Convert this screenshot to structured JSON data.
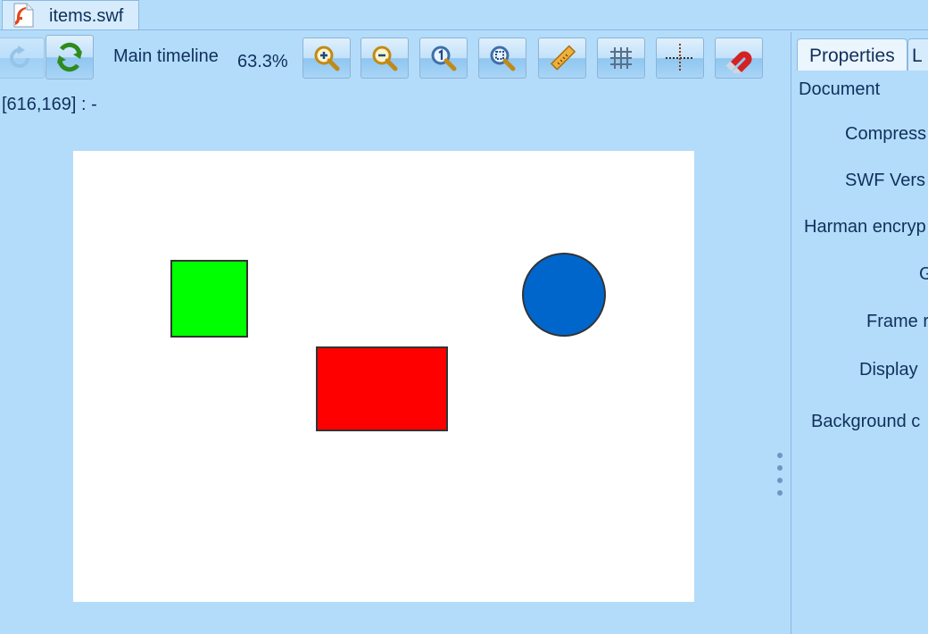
{
  "tab": {
    "filename": "items.swf"
  },
  "toolbar": {
    "timeline_label": "Main timeline",
    "zoom": "63.3%",
    "buttons": [
      "undo-icon",
      "refresh-icon",
      "zoom-in-icon",
      "zoom-out-icon",
      "zoom-actual-icon",
      "zoom-fit-icon",
      "ruler-icon",
      "grid-icon",
      "guides-icon",
      "snap-magnet-icon"
    ]
  },
  "status": {
    "coords": "[616,169] :  -"
  },
  "stage": {
    "background": "#ffffff",
    "shapes": [
      {
        "kind": "square",
        "color": "#00ff00"
      },
      {
        "kind": "rectangle",
        "color": "#ff0000"
      },
      {
        "kind": "circle",
        "color": "#0066cc"
      }
    ]
  },
  "panel": {
    "tabs": [
      "Properties",
      "L"
    ],
    "section": "Document",
    "fields": [
      "Compress",
      "SWF Vers",
      "Harman encryp",
      "G",
      "Frame r",
      "Display",
      "Background c"
    ]
  }
}
